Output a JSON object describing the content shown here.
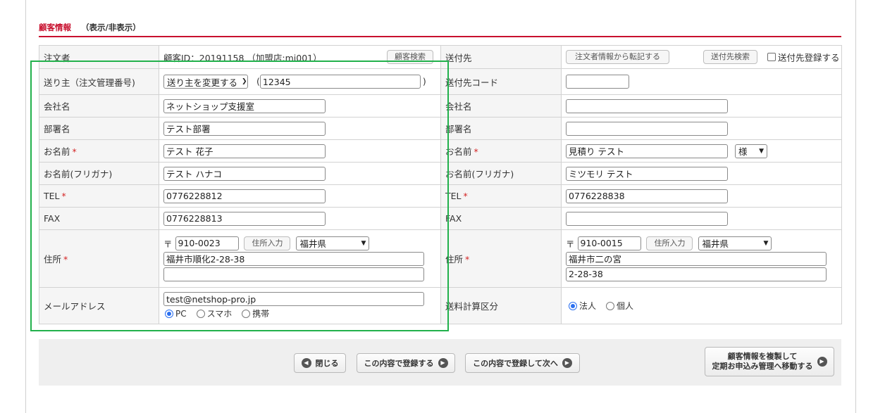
{
  "section": {
    "title": "顧客情報",
    "toggle": "（表示/非表示）"
  },
  "orderer": {
    "header_label": "注文者",
    "customer_id_text": "顧客ID：20191158 （加盟店:mi001）",
    "search_button": "顧客検索",
    "sender_label": "送り主（注文管理番号)",
    "sender_select": "送り主を変更する",
    "paren_open": "(",
    "sender_number": "12345",
    "paren_close": ")",
    "company_label": "会社名",
    "company": "ネットショップ支援室",
    "dept_label": "部署名",
    "dept": "テスト部署",
    "name_label": "お名前",
    "name": "テスト 花子",
    "kana_label": "お名前(フリガナ)",
    "kana": "テスト ハナコ",
    "tel_label": "TEL",
    "tel": "0776228812",
    "fax_label": "FAX",
    "fax": "0776228813",
    "address_label": "住所",
    "zip_mark": "〒",
    "zip": "910-0023",
    "address_input_button": "住所入力",
    "prefecture": "福井県",
    "address1": "福井市順化2-28-38",
    "address2": "",
    "email_label": "メールアドレス",
    "email": "test@netshop-pro.jp",
    "mail_types": [
      "PC",
      "スマホ",
      "携帯"
    ],
    "mail_type_selected": "PC"
  },
  "shipping": {
    "header_label": "送付先",
    "copy_button": "注文者情報から転記する",
    "search_button": "送付先検索",
    "register_label": "送付先登録する",
    "code_label": "送付先コード",
    "code": "",
    "company_label": "会社名",
    "company": "",
    "dept_label": "部署名",
    "dept": "",
    "name_label": "お名前",
    "name": "見積り テスト",
    "honorific": "様",
    "kana_label": "お名前(フリガナ)",
    "kana": "ミツモリ テスト",
    "tel_label": "TEL",
    "tel": "0776228838",
    "fax_label": "FAX",
    "fax": "",
    "address_label": "住所",
    "zip_mark": "〒",
    "zip": "910-0015",
    "address_input_button": "住所入力",
    "prefecture": "福井県",
    "address1": "福井市二の宮",
    "address2": "2-28-38",
    "fee_label": "送料計算区分",
    "fee_types": [
      "法人",
      "個人"
    ],
    "fee_type_selected": "法人"
  },
  "required_mark": "*",
  "footer": {
    "close": "閉じる",
    "register": "この内容で登録する",
    "register_next": "この内容で登録して次へ",
    "copy_line1": "顧客情報を複製して",
    "copy_line2": "定期お申込み管理へ移動する"
  },
  "colors": {
    "accent_red": "#c8102e",
    "highlight_green": "#22b14c",
    "radio_blue": "#2a6ff0"
  }
}
